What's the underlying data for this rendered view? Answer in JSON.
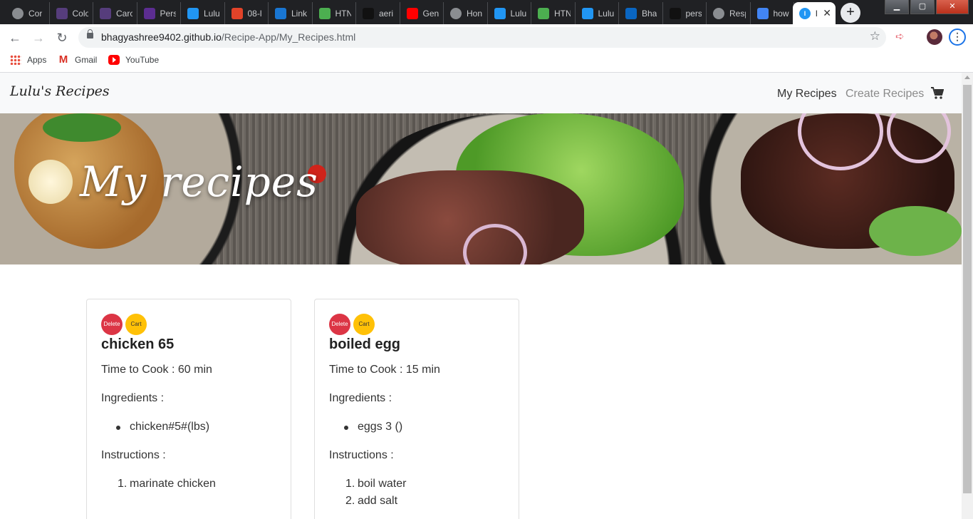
{
  "browser": {
    "tabs": [
      {
        "label": "Cor",
        "icon": "globe-icon",
        "color": "#8a8d91"
      },
      {
        "label": "Colo",
        "icon": "bootstrap-icon",
        "color": "#563d7c"
      },
      {
        "label": "Carc",
        "icon": "bootstrap-icon",
        "color": "#563d7c"
      },
      {
        "label": "Pers",
        "icon": "coolors-icon",
        "color": "#5c2d91"
      },
      {
        "label": "Lulu",
        "icon": "lulu-icon",
        "color": "#2196f3"
      },
      {
        "label": "08-l",
        "icon": "gitlab-icon",
        "color": "#e24329"
      },
      {
        "label": "Link",
        "icon": "flag-icon",
        "color": "#1976d2"
      },
      {
        "label": "HTN",
        "icon": "w3-icon",
        "color": "#4caf50"
      },
      {
        "label": "aeri",
        "icon": "blocks-icon",
        "color": "#111111"
      },
      {
        "label": "Gen",
        "icon": "youtube-icon",
        "color": "#ff0000"
      },
      {
        "label": "Hon",
        "icon": "globe-icon",
        "color": "#8a8d91"
      },
      {
        "label": "Lulu",
        "icon": "lulu-icon",
        "color": "#2196f3"
      },
      {
        "label": "HTN",
        "icon": "w3-icon",
        "color": "#4caf50"
      },
      {
        "label": "Lulu",
        "icon": "lulu-icon",
        "color": "#2196f3"
      },
      {
        "label": "Bha",
        "icon": "linkedin-icon",
        "color": "#0a66c2"
      },
      {
        "label": "pers",
        "icon": "blocks-icon",
        "color": "#111111"
      },
      {
        "label": "Resp",
        "icon": "globe-icon",
        "color": "#8a8d91"
      },
      {
        "label": "how",
        "icon": "google-icon",
        "color": "#4285f4"
      }
    ],
    "active_tab": {
      "label": "l",
      "icon": "lulu-icon"
    },
    "new_tab": "+",
    "window": {
      "minimize": "▁",
      "maximize": "▢",
      "close": "✕"
    },
    "url_host": "bhagyashree9402.github.io",
    "url_path": "/Recipe-App/My_Recipes.html",
    "bookmarks": [
      {
        "label": "Apps",
        "icon": "apps-grid-icon"
      },
      {
        "label": "Gmail",
        "icon": "gmail-icon"
      },
      {
        "label": "YouTube",
        "icon": "youtube-icon"
      }
    ]
  },
  "site": {
    "brand": "Lulu's Recipes",
    "nav_my_recipes": "My Recipes",
    "nav_create_recipes": "Create Recipes",
    "cart_icon": "shopping-cart-icon",
    "hero_title": "My recipes"
  },
  "recipes": [
    {
      "delete": "Delete",
      "cart": "Cart",
      "title": "chicken 65",
      "time_label": "Time to Cook : 60 min",
      "ingredients_label": "Ingredients :",
      "ingredients": [
        "chicken#5#(lbs)"
      ],
      "instructions_label": "Instructions :",
      "instructions": [
        "marinate chicken"
      ]
    },
    {
      "delete": "Delete",
      "cart": "Cart",
      "title": "boiled egg",
      "time_label": "Time to Cook : 15 min",
      "ingredients_label": "Ingredients :",
      "ingredients": [
        "eggs 3 ()"
      ],
      "instructions_label": "Instructions :",
      "instructions": [
        "boil water",
        "add salt"
      ]
    }
  ],
  "colors": {
    "delete": "#dc3545",
    "cart": "#ffc107",
    "navbar": "#f8f9fa"
  }
}
